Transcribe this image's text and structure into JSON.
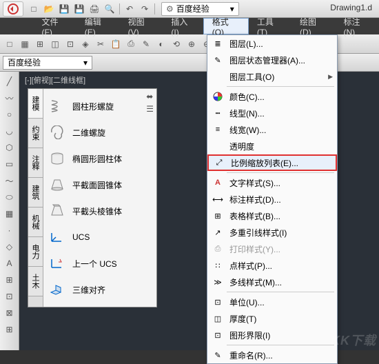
{
  "qat_dropdown_label": "百度经验",
  "title_doc": "Drawing1.d",
  "menu": {
    "file": "文件(F)",
    "edit": "编辑(E)",
    "view": "视图(V)",
    "insert": "插入(I)",
    "format": "格式(O)",
    "tools": "工具(T)",
    "draw": "绘图(D)",
    "dimension": "标注(N)"
  },
  "layer_dropdown": "百度经验",
  "view_tab": "[-][俯视][二维线框]",
  "panel": {
    "vtabs": [
      "建模",
      "约束",
      "注释",
      "建筑",
      "机械",
      "电力",
      "土木"
    ],
    "items": [
      "圆柱形螺旋",
      "二维螺旋",
      "椭圆形圆柱体",
      "平截面圆锥体",
      "平截头棱锥体",
      "UCS",
      "上一个 UCS",
      "三维对齐"
    ]
  },
  "format_menu": {
    "layer": "图层(L)...",
    "layer_state": "图层状态管理器(A)...",
    "layer_tools": "图层工具(O)",
    "color": "颜色(C)...",
    "linetype": "线型(N)...",
    "lineweight": "线宽(W)...",
    "transparency": "透明度",
    "scale_list": "比例缩放列表(E)...",
    "text_style": "文字样式(S)...",
    "dim_style": "标注样式(D)...",
    "table_style": "表格样式(B)...",
    "mleader_style": "多重引线样式(I)",
    "plot_style": "打印样式(Y)...",
    "point_style": "点样式(P)...",
    "mline_style": "多线样式(M)...",
    "units": "单位(U)...",
    "thickness": "厚度(T)",
    "limits": "图形界限(I)",
    "rename": "重命名(R)..."
  },
  "watermark": "KK下载"
}
